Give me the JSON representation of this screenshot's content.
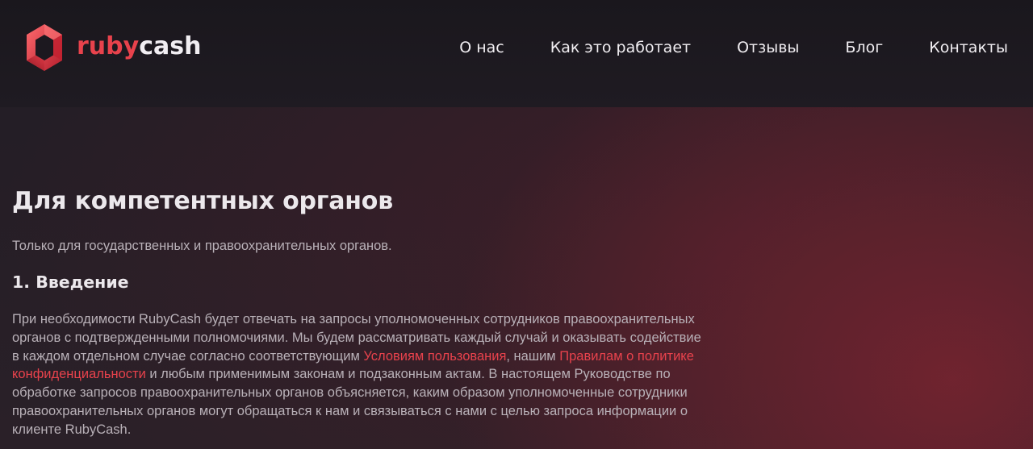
{
  "header": {
    "logo": {
      "part1": "ruby",
      "part2": "cash",
      "icon": "hexagon-logo-icon"
    },
    "nav": [
      {
        "label": "О нас"
      },
      {
        "label": "Как это работает"
      },
      {
        "label": "Отзывы"
      },
      {
        "label": "Блог"
      },
      {
        "label": "Контакты"
      }
    ]
  },
  "content": {
    "title": "Для компетентных органов",
    "subtitle": "Только для государственных и правоохранительных органов.",
    "section_title": "1. Введение",
    "intro": {
      "text1": "При необходимости RubyCash будет отвечать на запросы уполномоченных сотрудников правоохранительных органов с подтвержденными полномочиями. Мы будем рассматривать каждый случай и оказывать содействие в каждом отдельном случае согласно соответствующим ",
      "link1": "Условиям пользования",
      "text2": ", нашим ",
      "link2": "Правилам о политике конфиденциальности",
      "text3": " и любым применимым законам и подзаконным актам. В настоящем Руководстве по обработке запросов правоохранительных органов объясняется, каким образом уполномоченные сотрудники правоохранительных органов могут обращаться к нам и связываться с нами с целью запроса информации о клиенте RubyCash."
    }
  },
  "colors": {
    "accent": "#e8424c",
    "header_bg": "#1c181f",
    "body_text": "#b9b1b8",
    "heading_text": "#ece8ec"
  }
}
